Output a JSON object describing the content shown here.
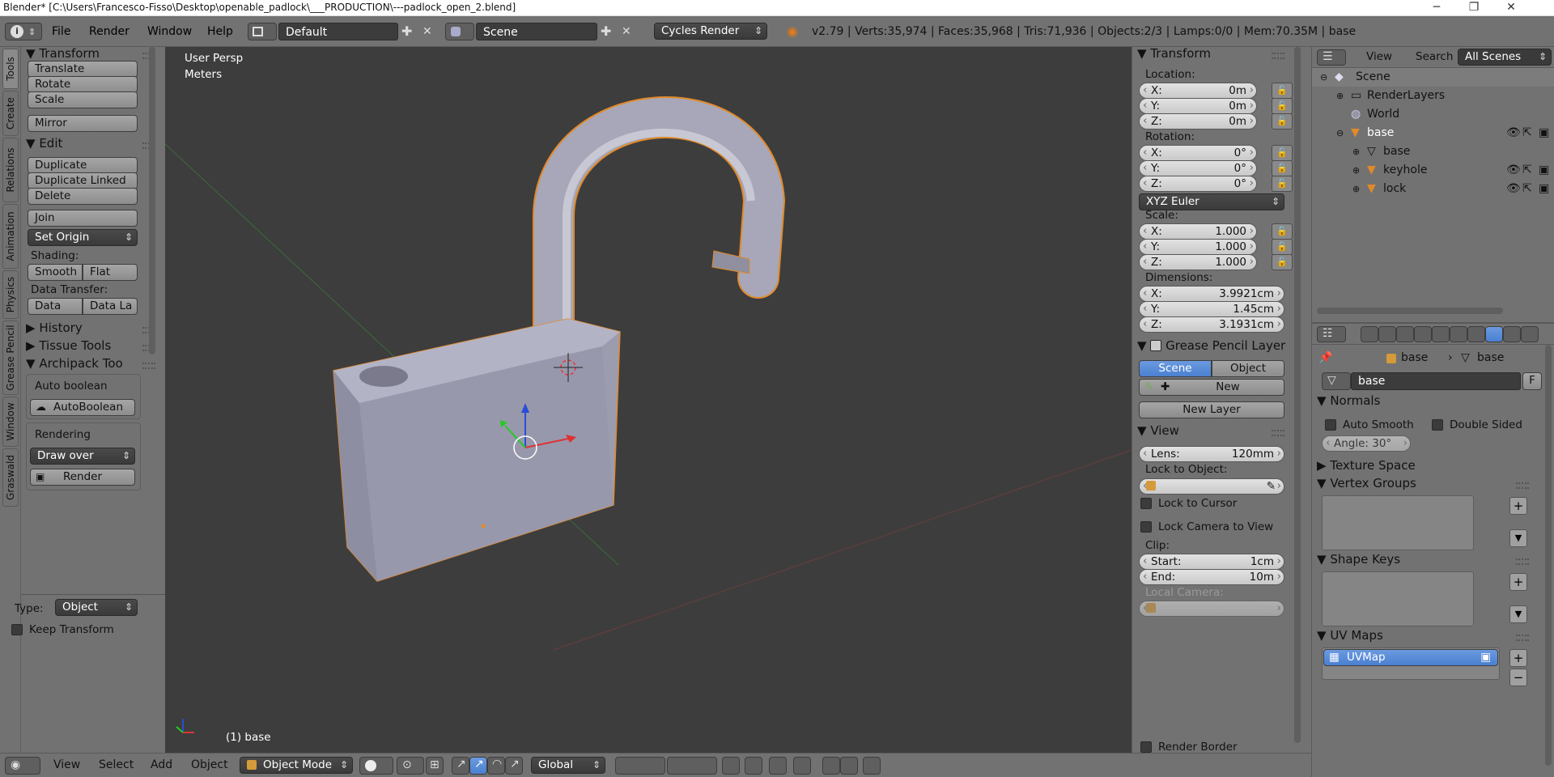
{
  "window": {
    "title": "Blender* [C:\\Users\\Francesco-Fisso\\Desktop\\openable_padlock\\___PRODUCTION\\---padlock_open_2.blend]",
    "minimize": "─",
    "maximize": "❐",
    "close": "✕"
  },
  "info_header": {
    "menus": [
      "File",
      "Render",
      "Window",
      "Help"
    ],
    "screen_layout": "Default",
    "scene": "Scene",
    "render_engine": "Cycles Render",
    "stats": "v2.79 | Verts:35,974 | Faces:35,968 | Tris:71,936 | Objects:2/3 | Lamps:0/0 | Mem:70.35M | base"
  },
  "toolshelf": {
    "tabs": [
      "Tools",
      "Create",
      "Relations",
      "Animation",
      "Physics",
      "Grease Pencil",
      "Window",
      "Graswald"
    ],
    "transform": {
      "title": "Transform",
      "translate": "Translate",
      "rotate": "Rotate",
      "scale": "Scale",
      "mirror": "Mirror"
    },
    "edit": {
      "title": "Edit",
      "duplicate": "Duplicate",
      "duplicate_linked": "Duplicate Linked",
      "delete": "Delete",
      "join": "Join",
      "set_origin": "Set Origin",
      "shading": "Shading:",
      "smooth": "Smooth",
      "flat": "Flat",
      "data_transfer": "Data Transfer:",
      "data": "Data",
      "data_la": "Data La"
    },
    "history": "History",
    "tissue_tools": "Tissue Tools",
    "archipack": {
      "title": "Archipack Too",
      "auto_boolean_label": "Auto boolean",
      "auto_boolean_btn": "AutoBoolean",
      "rendering_label": "Rendering",
      "draw_over": "Draw over",
      "render": "Render"
    },
    "redo": {
      "type_label": "Type:",
      "type_value": "Object",
      "keep_transform": "Keep Transform"
    }
  },
  "viewport": {
    "view_name": "User Persp",
    "units": "Meters",
    "object_label": "(1) base"
  },
  "n_panel": {
    "transform_title": "Transform",
    "location_label": "Location:",
    "location": [
      {
        "k": "X:",
        "v": "0m"
      },
      {
        "k": "Y:",
        "v": "0m"
      },
      {
        "k": "Z:",
        "v": "0m"
      }
    ],
    "rotation_label": "Rotation:",
    "rotation": [
      {
        "k": "X:",
        "v": "0°"
      },
      {
        "k": "Y:",
        "v": "0°"
      },
      {
        "k": "Z:",
        "v": "0°"
      }
    ],
    "rotation_mode": "XYZ Euler",
    "scale_label": "Scale:",
    "scale": [
      {
        "k": "X:",
        "v": "1.000"
      },
      {
        "k": "Y:",
        "v": "1.000"
      },
      {
        "k": "Z:",
        "v": "1.000"
      }
    ],
    "dimensions_label": "Dimensions:",
    "dimensions": [
      {
        "k": "X:",
        "v": "3.9921cm"
      },
      {
        "k": "Y:",
        "v": "1.45cm"
      },
      {
        "k": "Z:",
        "v": "3.1931cm"
      }
    ],
    "grease_pencil_title": "Grease Pencil Layer",
    "gp_scene": "Scene",
    "gp_object": "Object",
    "gp_new": "New",
    "gp_new_layer": "New Layer",
    "view_title": "View",
    "lens_label": "Lens:",
    "lens_value": "120mm",
    "lock_to_object": "Lock to Object:",
    "lock_to_cursor": "Lock to Cursor",
    "lock_camera": "Lock Camera to View",
    "clip_label": "Clip:",
    "clip_start_k": "Start:",
    "clip_start_v": "1cm",
    "clip_end_k": "End:",
    "clip_end_v": "10m",
    "local_camera": "Local Camera:",
    "render_border": "Render Border"
  },
  "outliner": {
    "view": "View",
    "search": "Search",
    "all_scenes": "All Scenes",
    "items": [
      "Scene",
      "RenderLayers",
      "World",
      "base",
      "base",
      "keyhole",
      "lock"
    ]
  },
  "properties": {
    "breadcrumb_obj": "base",
    "breadcrumb_mesh": "base",
    "mesh_name": "base",
    "fake_user": "F",
    "normals_title": "Normals",
    "auto_smooth": "Auto Smooth",
    "double_sided": "Double Sided",
    "angle": "Angle:   30°",
    "texture_space": "Texture Space",
    "vertex_groups": "Vertex Groups",
    "shape_keys": "Shape Keys",
    "uv_maps": "UV Maps",
    "uv_map_item": "UVMap"
  },
  "bottom_bar": {
    "view": "View",
    "select": "Select",
    "add": "Add",
    "object": "Object",
    "mode": "Object Mode",
    "orientation": "Global"
  },
  "colors": {
    "panel_bg": "#727272",
    "viewport_bg": "#3d3d3d",
    "accent_blue": "#5a8ee0",
    "selection_orange": "#f39c2a"
  }
}
